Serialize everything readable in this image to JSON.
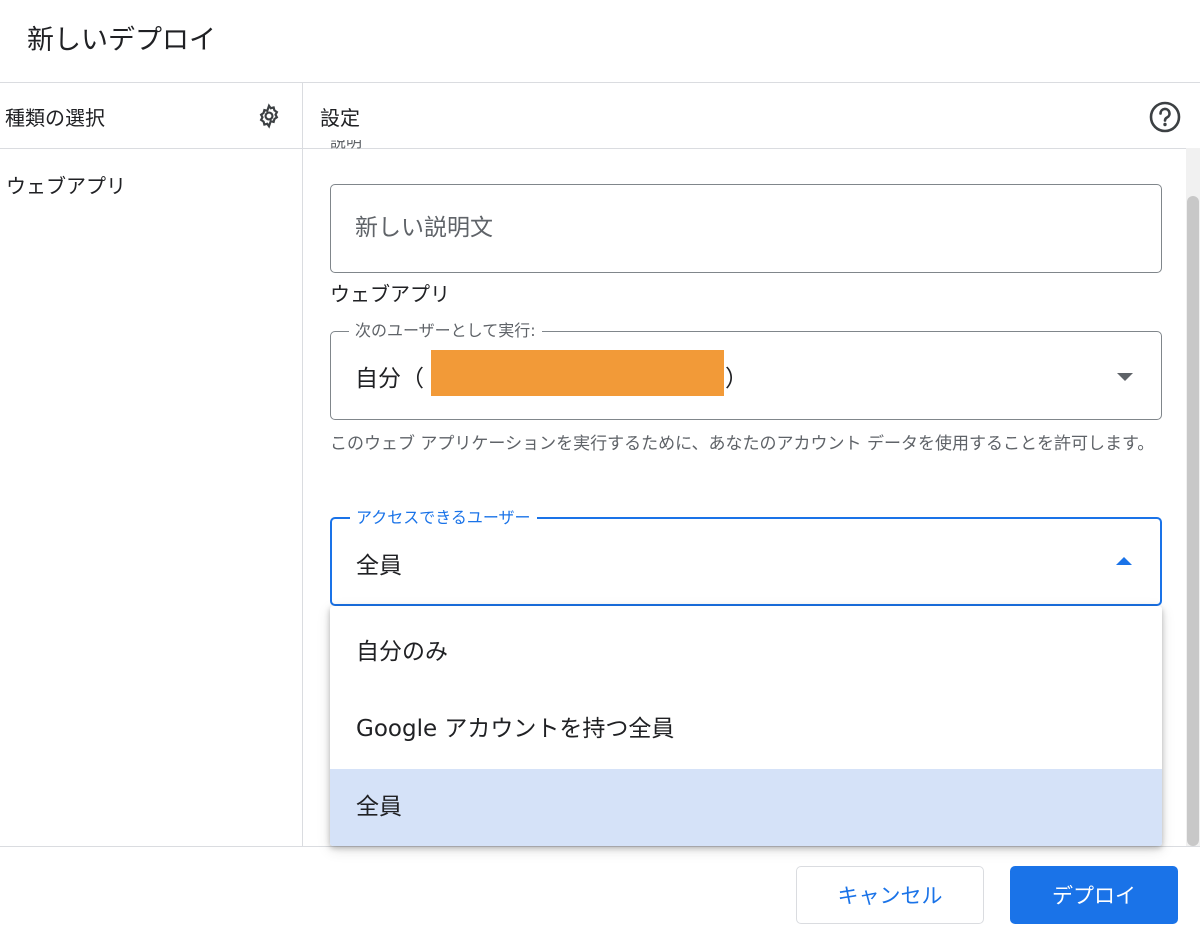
{
  "dialog": {
    "title": "新しいデプロイ"
  },
  "left_panel": {
    "header": "種類の選択",
    "settings_icon": "gear-icon",
    "items": [
      {
        "label": "ウェブアプリ"
      }
    ]
  },
  "right_panel": {
    "header": "設定",
    "help_icon": "help-circle-icon",
    "clipped_label": "説明",
    "description": {
      "value": "",
      "placeholder": "新しい説明文"
    },
    "section_label": "ウェブアプリ",
    "execute_as": {
      "label": "次のユーザーとして実行:",
      "value_prefix": "自分（",
      "value_suffix": "）",
      "helper_text": "このウェブ アプリケーションを実行するために、あなたのアカウント データを使用することを許可します。"
    },
    "access": {
      "label": "アクセスできるユーザー",
      "value": "全員",
      "options": [
        {
          "label": "自分のみ"
        },
        {
          "label": "Google アカウントを持つ全員"
        },
        {
          "label": "全員"
        }
      ]
    }
  },
  "footer": {
    "cancel_label": "キャンセル",
    "deploy_label": "デプロイ"
  },
  "colors": {
    "accent": "#1a73e8",
    "selected_option_bg": "#d5e2f8",
    "redaction": "#f29a38"
  }
}
